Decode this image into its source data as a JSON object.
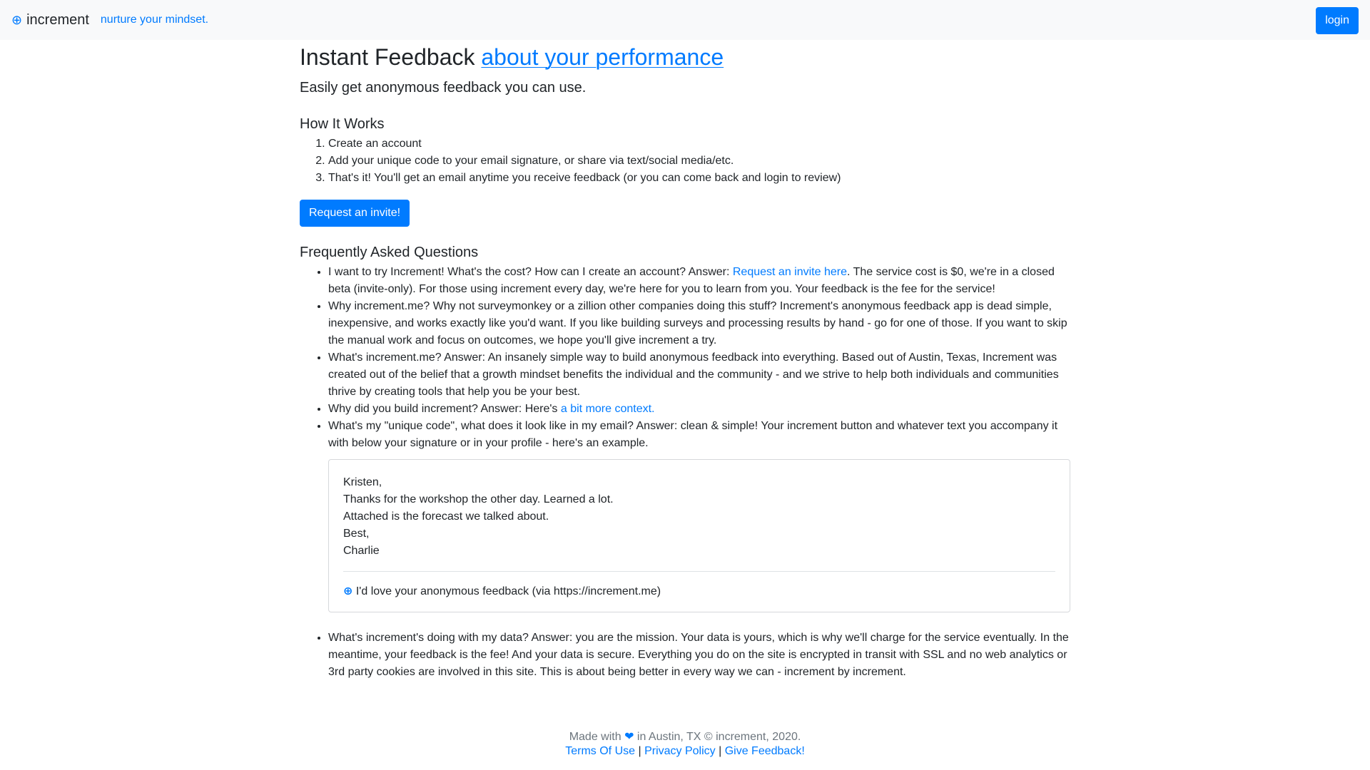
{
  "nav": {
    "brand_icon": "⊕",
    "brand": "increment",
    "tagline": "nurture your mindset.",
    "login_label": "login"
  },
  "hero": {
    "title_prefix": "Instant Feedback ",
    "title_link": "about your performance",
    "subtitle": "Easily get anonymous feedback you can use."
  },
  "how": {
    "heading": "How It Works",
    "steps": [
      "Create an account",
      "Add your unique code to your email signature, or share via text/social media/etc.",
      "That's it! You'll get an email anytime you receive feedback (or you can come back and login to review)"
    ],
    "cta_label": "Request an invite!"
  },
  "faq": {
    "heading": "Frequently Asked Questions",
    "q1_a": "I want to try Increment! What's the cost? How can I create an account? Answer: ",
    "q1_link": "Request an invite here",
    "q1_b": ". The service cost is $0, we're in a closed beta (invite-only). For those using increment every day, we're here for you to learn from you. Your feedback is the fee for the service!",
    "q2": "Why increment.me? Why not surveymonkey or a zillion other companies doing this stuff? Increment's anonymous feedback app is dead simple, inexpensive, and works exactly like you'd want. If you like building surveys and processing results by hand - go for one of those. If you want to skip the manual work and focus on outcomes, we hope you'll give increment a try.",
    "q3": "What's increment.me? Answer: An insanely simple way to build anonymous feedback into everything. Based out of Austin, Texas, Increment was created out of the belief that a growth mindset benefits the individual and the community - and we strive to help both individuals and communities thrive by creating tools that help you be your best.",
    "q4_a": "Why did you build increment? Answer: Here's ",
    "q4_link": "a bit more context.",
    "q5": "What's my \"unique code\", what does it look like in my email? Answer: clean & simple! Your increment button and whatever text you accompany it with below your signature or in your profile - here's an example.",
    "example": {
      "lines": [
        "Kristen,",
        "Thanks for the workshop the other day. Learned a lot.",
        "Attached is the forecast we talked about.",
        "Best,",
        "Charlie"
      ],
      "sig_icon": "⊕",
      "sig_text": " I'd love your anonymous feedback (via https://increment.me)"
    },
    "q6": "What's increment's doing with my data? Answer: you are the mission. Your data is yours, which is why we'll charge for the service eventually. In the meantime, your feedback is the fee! And your data is secure. Everything you do on the site is encrypted in transit with SSL and no web analytics or 3rd party cookies are involved in this site. This is about being better in every way we can - increment by increment."
  },
  "footer": {
    "made_a": "Made with ",
    "heart": "❤",
    "made_b": " in Austin, TX © increment, 2020.",
    "terms": "Terms Of Use",
    "sep": " | ",
    "privacy": "Privacy Policy",
    "feedback": "Give Feedback!"
  },
  "colors": {
    "primary": "#007bff",
    "navbar_bg": "#f8f9fa",
    "text": "#212529",
    "muted": "#6c757d"
  }
}
